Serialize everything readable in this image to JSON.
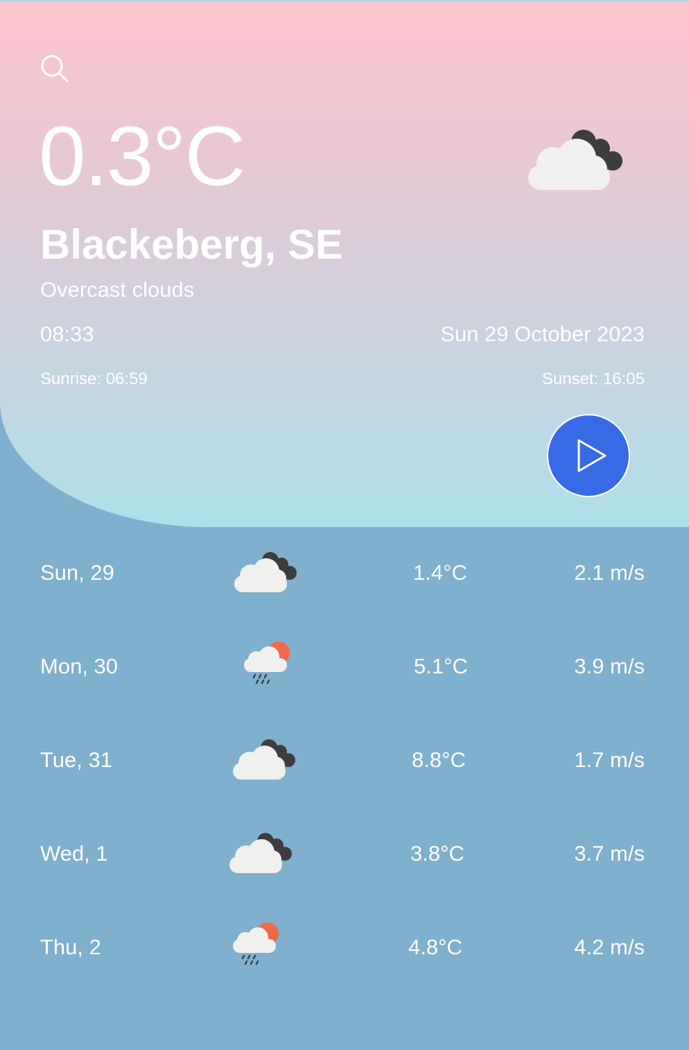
{
  "current": {
    "temperature": "0.3°C",
    "city": "Blackeberg, SE",
    "description": "Overcast clouds",
    "time": "08:33",
    "date": "Sun 29 October 2023",
    "sunrise": "Sunrise: 06:59",
    "sunset": "Sunset: 16:05",
    "icon": "overcast-clouds-icon"
  },
  "colors": {
    "gradient_top": "#ffc6cf",
    "gradient_bottom": "#ade0ea",
    "forecast_bg": "#7fb0ce",
    "play_button": "#376be6",
    "sun": "#ef6a4c"
  },
  "forecast": [
    {
      "day": "Sun, 29",
      "icon": "overcast-clouds-icon",
      "temp": "1.4°C",
      "wind": "2.1 m/s"
    },
    {
      "day": "Mon, 30",
      "icon": "rain-sun-icon",
      "temp": "5.1°C",
      "wind": "3.9 m/s"
    },
    {
      "day": "Tue, 31",
      "icon": "overcast-clouds-icon",
      "temp": "8.8°C",
      "wind": "1.7 m/s"
    },
    {
      "day": "Wed, 1",
      "icon": "overcast-clouds-icon",
      "temp": "3.8°C",
      "wind": "3.7 m/s"
    },
    {
      "day": "Thu, 2",
      "icon": "rain-sun-icon",
      "temp": "4.8°C",
      "wind": "4.2 m/s"
    }
  ]
}
